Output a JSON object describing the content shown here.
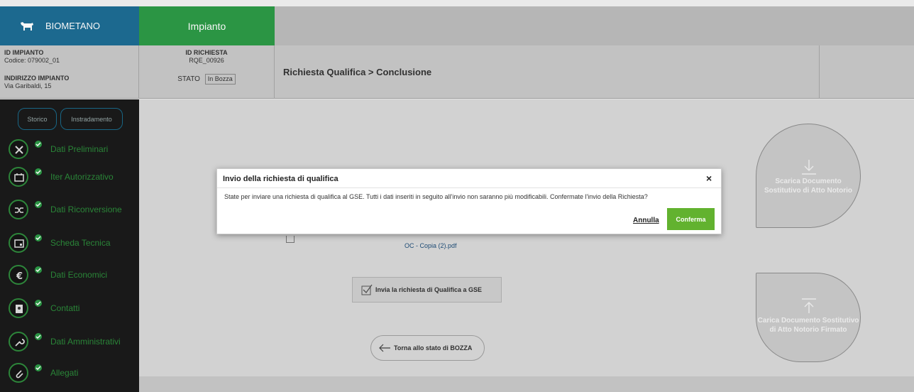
{
  "header": {
    "brand": "BIOMETANO",
    "brand_icon": "cow-icon",
    "tab": "Impianto"
  },
  "info": {
    "impianto_label": "ID IMPIANTO",
    "impianto_code": "Codice: 079002_01",
    "indirizzo_label": "INDIRIZZO IMPIANTO",
    "indirizzo_value": "Via Garibaldi, 15",
    "richiesta_label": "ID RICHIESTA",
    "richiesta_value": "RQE_00926",
    "stato_label": "STATO",
    "stato_value": "In Bozza",
    "breadcrumb": "Richiesta Qualifica > Conclusione"
  },
  "sidebar": {
    "storico": "Storico",
    "instradamento": "Instradamento",
    "items": [
      {
        "label": "Dati Preliminari",
        "icon": "tools-icon"
      },
      {
        "label": "Iter Autorizzativo",
        "icon": "calendar-icon"
      },
      {
        "label": "Dati Riconversione",
        "icon": "shuffle-icon"
      },
      {
        "label": "Scheda Tecnica",
        "icon": "card-icon"
      },
      {
        "label": "Dati Economici",
        "icon": "euro-icon"
      },
      {
        "label": "Contatti",
        "icon": "contacts-icon"
      },
      {
        "label": "Dati Amministrativi",
        "icon": "wrench-icon"
      },
      {
        "label": "Allegati",
        "icon": "paperclip-icon"
      }
    ]
  },
  "main": {
    "file_name": "OC - Copia (2).pdf",
    "invia_button": "Invia la richiesta di Qualifica a GSE",
    "torna_button": "Torna allo stato di BOZZA",
    "scarica": "Scarica Documento Sostitutivo di Atto Notorio",
    "carica": "Carica Documento Sostitutivo di Atto Notorio Firmato"
  },
  "modal": {
    "title": "Invio della richiesta di qualifica",
    "close": "×",
    "message": "State per inviare una richiesta di qualifica al GSE. Tutti i dati inseriti in seguito all'invio non saranno più modificabili. Confermate l'invio della Richiesta?",
    "cancel": "Annulla",
    "confirm": "Conferma"
  },
  "colors": {
    "brand_blue": "#1d6d94",
    "tab_green": "#2d9a47",
    "confirm_green": "#62b22f",
    "sidebar_bg": "#1a1a1a"
  }
}
